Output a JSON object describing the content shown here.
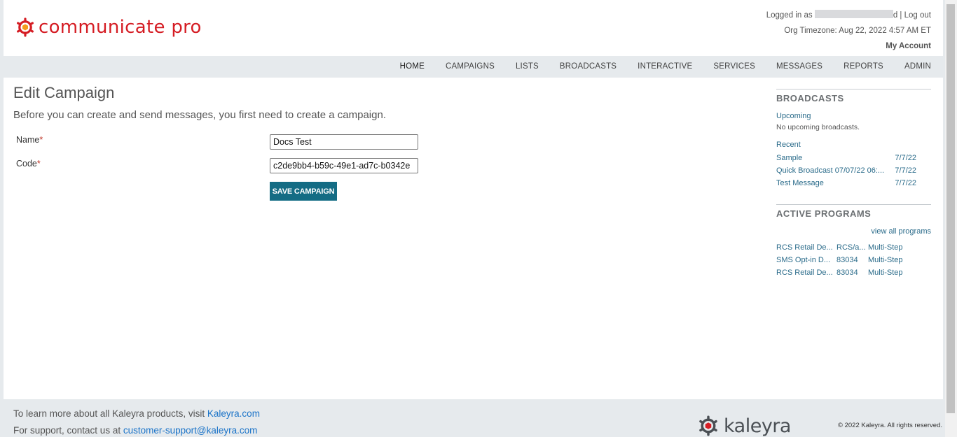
{
  "header": {
    "logo_text": "communicate pro",
    "logged_in_prefix": "Logged in as",
    "logged_in_suffix": "d",
    "logout_separator": "|",
    "logout_label": "Log out",
    "timezone": "Org Timezone: Aug 22, 2022 4:57 AM ET",
    "my_account_label": "My Account"
  },
  "nav": {
    "items": [
      "HOME",
      "CAMPAIGNS",
      "LISTS",
      "BROADCASTS",
      "INTERACTIVE",
      "SERVICES",
      "MESSAGES",
      "REPORTS",
      "ADMIN"
    ],
    "active": "HOME"
  },
  "main": {
    "title": "Edit Campaign",
    "intro": "Before you can create and send messages, you first need to create a campaign.",
    "name_label": "Name",
    "name_value": "Docs Test",
    "code_label": "Code",
    "code_value": "c2de9bb4-b59c-49e1-ad7c-b0342e",
    "required_mark": "*",
    "save_label": "SAVE CAMPAIGN"
  },
  "sidebar": {
    "broadcasts_title": "BROADCASTS",
    "upcoming_label": "Upcoming",
    "no_upcoming": "No upcoming broadcasts.",
    "recent_label": "Recent",
    "recent": [
      {
        "name": "Sample",
        "date": "7/7/22"
      },
      {
        "name": "Quick Broadcast 07/07/22 06:...",
        "date": "7/7/22"
      },
      {
        "name": "Test Message",
        "date": "7/7/22"
      }
    ],
    "programs_title": "ACTIVE PROGRAMS",
    "view_all_label": "view all programs",
    "programs": [
      {
        "name": "RCS Retail De...",
        "code": "RCS/a...",
        "type": "Multi-Step"
      },
      {
        "name": "SMS Opt-in D...",
        "code": "83034",
        "type": "Multi-Step"
      },
      {
        "name": "RCS Retail De...",
        "code": "83034",
        "type": "Multi-Step"
      }
    ]
  },
  "footer": {
    "learn_prefix": "To learn more about all Kaleyra products, visit",
    "learn_link": "Kaleyra.com",
    "support_prefix": "For support, contact us at",
    "support_link": "customer-support@kaleyra.com",
    "brand": "kaleyra",
    "copyright": "© 2022 Kaleyra. All rights reserved."
  },
  "colors": {
    "brand_red": "#d51d24",
    "accent_teal": "#146c84",
    "link_blue": "#2a6b8a",
    "footer_link": "#1a73c8"
  }
}
